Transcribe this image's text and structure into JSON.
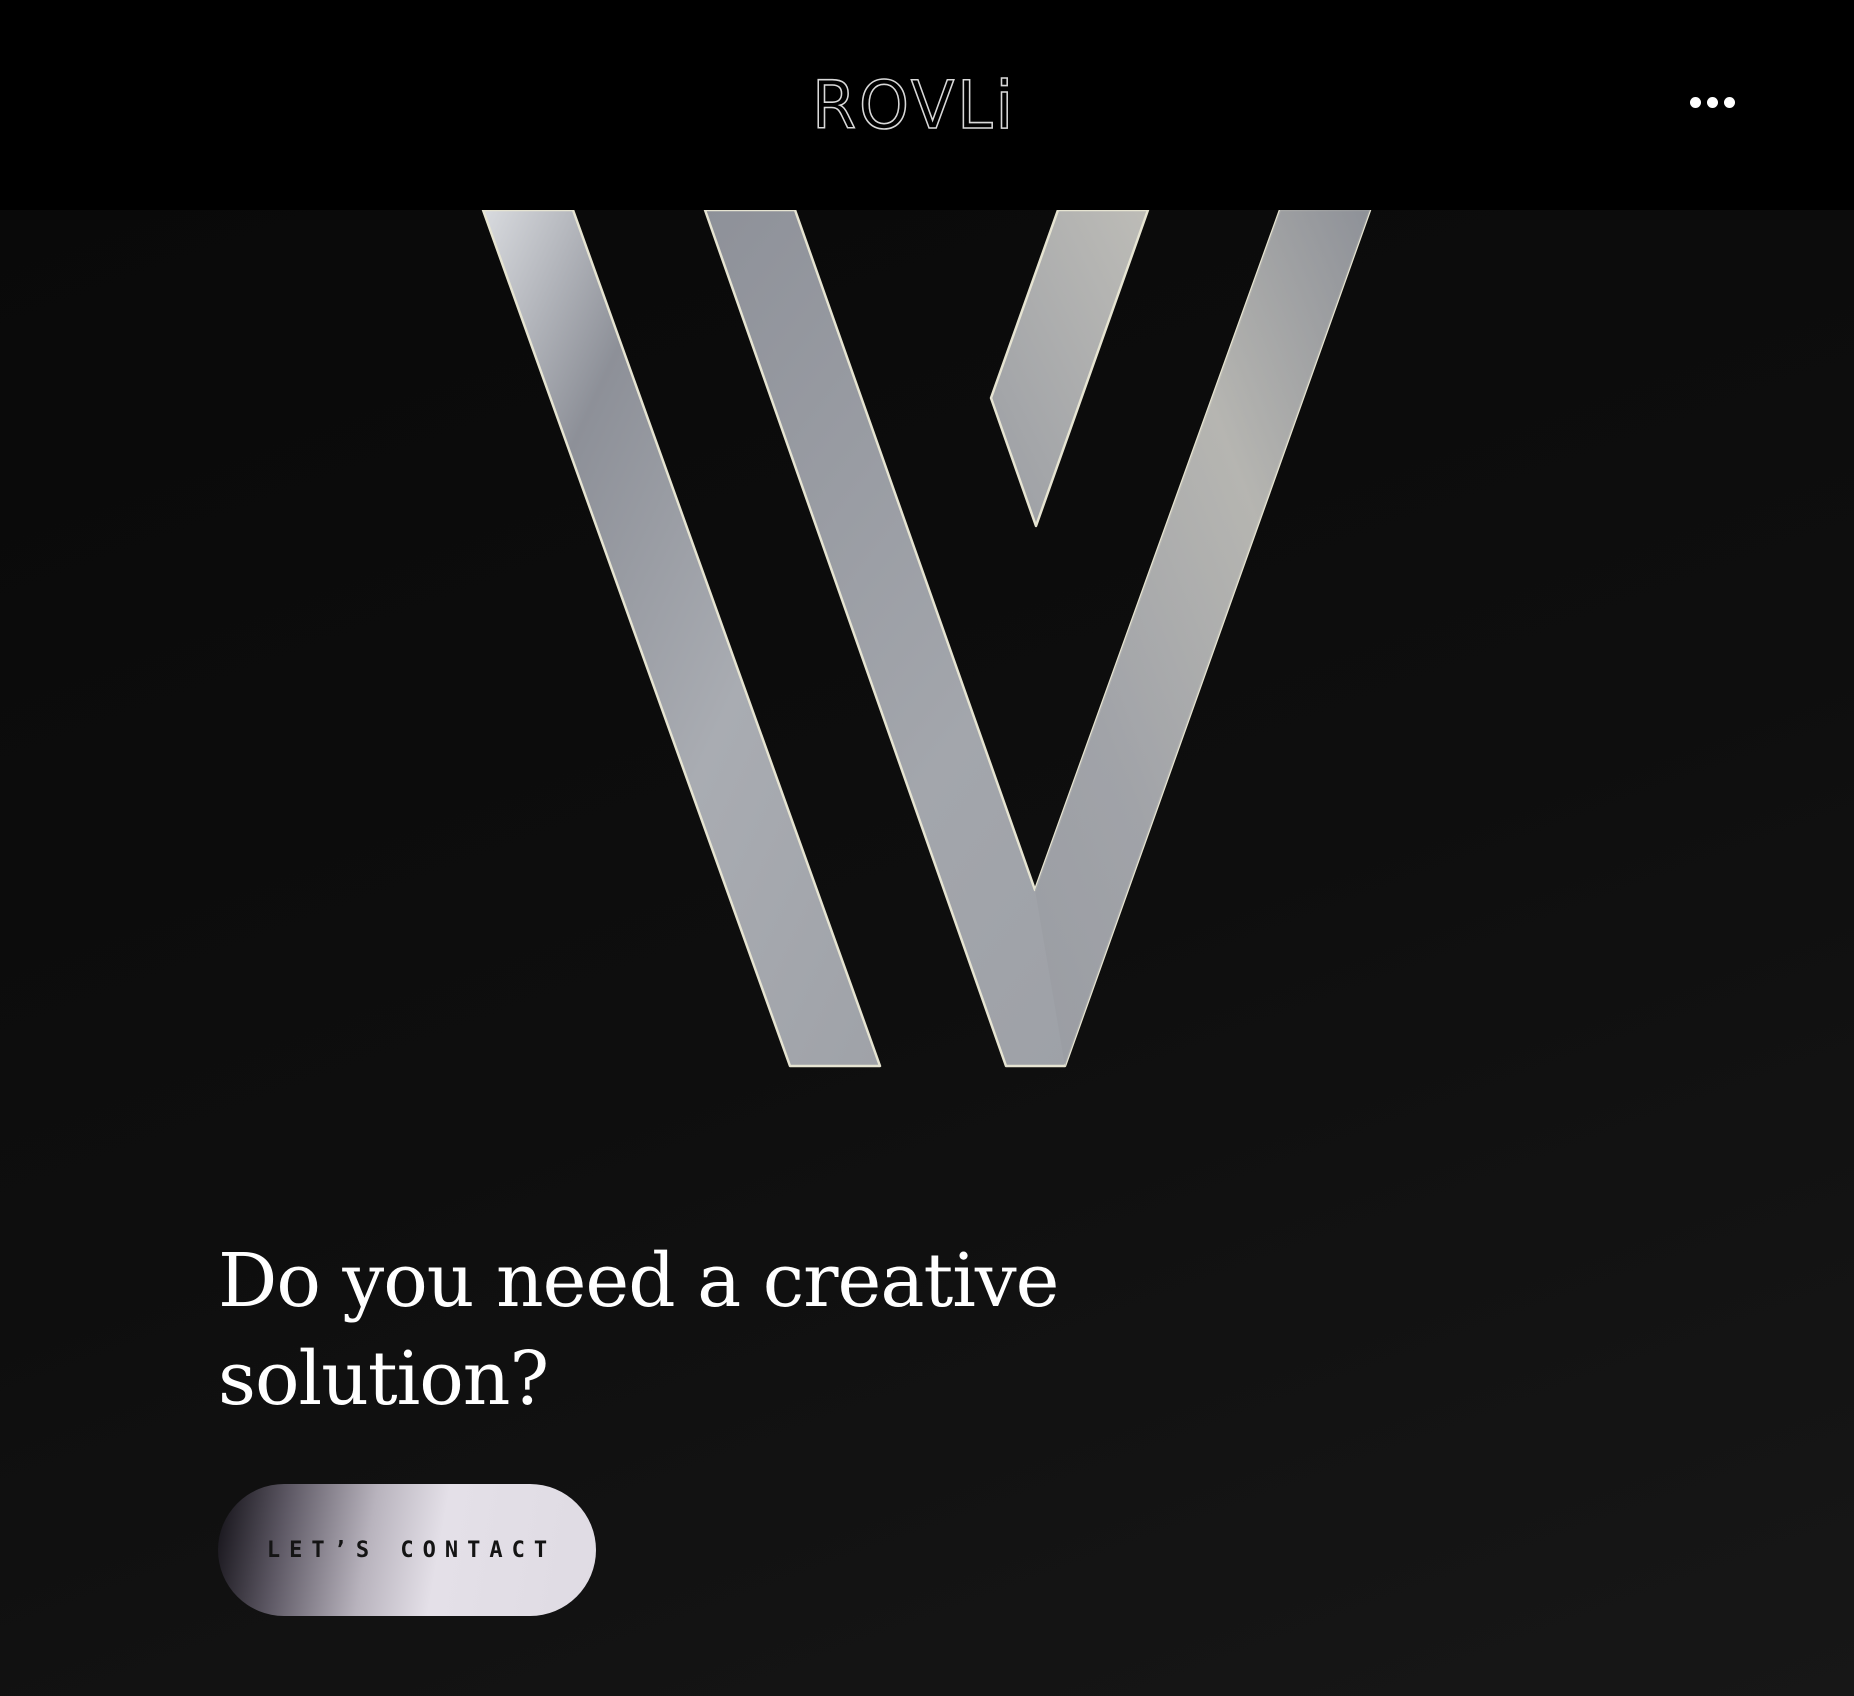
{
  "header": {
    "logo_text": "ROVLi",
    "menu_icon": "more-horizontal-icon"
  },
  "hero": {
    "emblem_icon": "chrome-v-emblem-icon",
    "title": "Do you need a creative solution?",
    "cta_label": "LET’S CONTACT"
  },
  "colors": {
    "header_background": "#000000",
    "page_background": "#0c0c0c",
    "title_text": "#ffffff",
    "emblem_metal": "#a3a6ac",
    "cta_light": "#e4e0e8"
  }
}
